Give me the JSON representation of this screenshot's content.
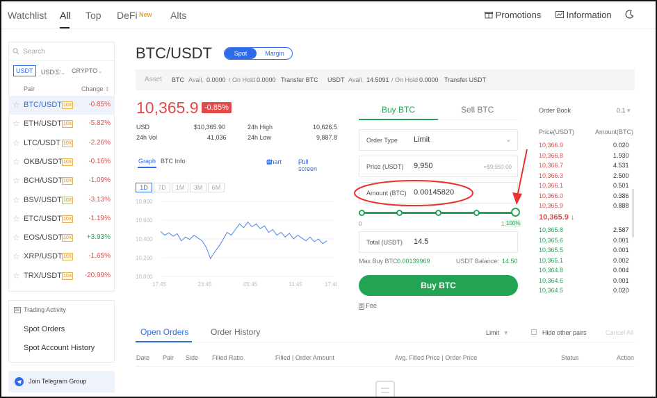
{
  "nav": {
    "items": [
      "Watchlist",
      "All",
      "Top",
      "DeFi",
      "Alts"
    ],
    "new_badge": "New",
    "promotions": "Promotions",
    "information": "Information"
  },
  "sidebar": {
    "search_placeholder": "Search",
    "currencies": [
      "USDT",
      "USDⓈ",
      "CRYPTO"
    ],
    "col_pair": "Pair",
    "col_change": "Change",
    "pairs": [
      {
        "name": "BTC/USDT",
        "lev": "10X",
        "change": "-0.85%",
        "dir": "neg"
      },
      {
        "name": "ETH/USDT",
        "lev": "10X",
        "change": "-5.82%",
        "dir": "neg"
      },
      {
        "name": "LTC/USDT",
        "lev": "10X",
        "change": "-2.26%",
        "dir": "neg"
      },
      {
        "name": "OKB/USDT",
        "lev": "10X",
        "change": "-0.16%",
        "dir": "neg"
      },
      {
        "name": "BCH/USDT",
        "lev": "10X",
        "change": "-1.09%",
        "dir": "neg"
      },
      {
        "name": "BSV/USDT",
        "lev": "10X",
        "change": "-3.13%",
        "dir": "neg"
      },
      {
        "name": "ETC/USDT",
        "lev": "10X",
        "change": "-1.19%",
        "dir": "neg"
      },
      {
        "name": "EOS/USDT",
        "lev": "10X",
        "change": "+3.93%",
        "dir": "pos"
      },
      {
        "name": "XRP/USDT",
        "lev": "10X",
        "change": "-1.65%",
        "dir": "neg"
      },
      {
        "name": "TRX/USDT",
        "lev": "10X",
        "change": "-20.99%",
        "dir": "neg"
      }
    ],
    "trading_activity": "Trading Activity",
    "spot_orders": "Spot Orders",
    "spot_history": "Spot Account History",
    "telegram": "Join Telegram Group"
  },
  "header": {
    "pair": "BTC/USDT",
    "spot": "Spot",
    "margin": "Margin"
  },
  "asset": {
    "label": "Asset",
    "btc": "BTC",
    "avail": "Avail.",
    "btc_avail": "0.0000",
    "on_hold": "/ On Hold",
    "btc_hold": "0.0000",
    "transfer_btc": "Transfer BTC",
    "usdt": "USDT",
    "usdt_avail": "14.5091",
    "usdt_hold": "0.0000",
    "transfer_usdt": "Transfer USDT"
  },
  "ticker": {
    "price": "10,365.9",
    "change": "-0.85%",
    "usd_label": "USD",
    "usd": "$10,365.90",
    "high_label": "24h High",
    "high": "10,626.5",
    "vol_label": "24h Vol",
    "vol": "41,036",
    "low_label": "24h Low",
    "low": "9,887.8"
  },
  "chart_panel": {
    "graph": "Graph",
    "btc_info": "BTC Info",
    "chart": "Chart",
    "fullscreen": "Full screen",
    "ranges": [
      "1D",
      "7D",
      "1M",
      "3M",
      "6M"
    ],
    "yticks": [
      "10,800",
      "10,600",
      "10,400",
      "10,200",
      "10,000"
    ],
    "xticks": [
      "17:45",
      "23:45",
      "05:45",
      "11:45",
      "17:40"
    ]
  },
  "chart_data": {
    "type": "line",
    "x": [
      "17:45",
      "23:45",
      "05:45",
      "11:45",
      "17:40"
    ],
    "ylim": [
      10000,
      10800
    ],
    "series": [
      {
        "values": [
          10480,
          10440,
          10465,
          10430,
          10455,
          10380,
          10420,
          10395,
          10440,
          10410,
          10380,
          10310,
          10190,
          10260,
          10320,
          10390,
          10470,
          10440,
          10500,
          10560,
          10520,
          10580,
          10530,
          10560,
          10510,
          10540,
          10470,
          10500,
          10440,
          10470,
          10420,
          10460,
          10400,
          10440,
          10410,
          10380,
          10420,
          10370,
          10400,
          10350,
          10380
        ]
      }
    ]
  },
  "order": {
    "buy_tab": "Buy BTC",
    "sell_tab": "Sell BTC",
    "type_label": "Order Type",
    "type_value": "Limit",
    "price_label": "Price (USDT)",
    "price_value": "9,950",
    "price_hint": "≈$9,950.00",
    "amount_label": "Amount (BTC)",
    "amount_value": "0.00145820",
    "slider_min": "0",
    "slider_max": "1",
    "slider_pct": "100%",
    "slider_level": 1.0,
    "total_label": "Total (USDT)",
    "total_value": "14.5",
    "max_buy_label": "Max Buy BTC:",
    "max_buy": "0.00139969",
    "balance_label": "USDT Balance:",
    "balance": "14.50",
    "buy_button": "Buy BTC",
    "fee": "Fee"
  },
  "orderbook": {
    "title": "Order Book",
    "step": "0.1",
    "col_price": "Price(USDT)",
    "col_amount": "Amount(BTC)",
    "asks": [
      {
        "p": "10,366.9",
        "a": "0.020"
      },
      {
        "p": "10,366.8",
        "a": "1.930"
      },
      {
        "p": "10,366.7",
        "a": "4.531"
      },
      {
        "p": "10,366.3",
        "a": "2.500"
      },
      {
        "p": "10,366.1",
        "a": "0.501"
      },
      {
        "p": "10,366.0",
        "a": "0.386"
      },
      {
        "p": "10,365.9",
        "a": "0.888"
      }
    ],
    "last": "10,365.9",
    "bids": [
      {
        "p": "10,365.8",
        "a": "2.587"
      },
      {
        "p": "10,365.6",
        "a": "0.001"
      },
      {
        "p": "10,365.5",
        "a": "0.001"
      },
      {
        "p": "10,365.1",
        "a": "0.002"
      },
      {
        "p": "10,364.8",
        "a": "0.004"
      },
      {
        "p": "10,364.6",
        "a": "0.001"
      },
      {
        "p": "10,364.5",
        "a": "0.020"
      }
    ]
  },
  "orders": {
    "open": "Open Orders",
    "history": "Order History",
    "filter": "Limit",
    "hide_other": "Hide other pairs",
    "cancel_all": "Cancel All",
    "cols": [
      "Date",
      "Pair",
      "Side",
      "Filled Ratio",
      "Filled | Order Amount",
      "Avg. Filled Price | Order Price",
      "Status",
      "Action"
    ]
  },
  "colors": {
    "red": "#e24a4a",
    "green": "#23a455",
    "blue": "#2e6be6",
    "annot": "#e8332e"
  }
}
